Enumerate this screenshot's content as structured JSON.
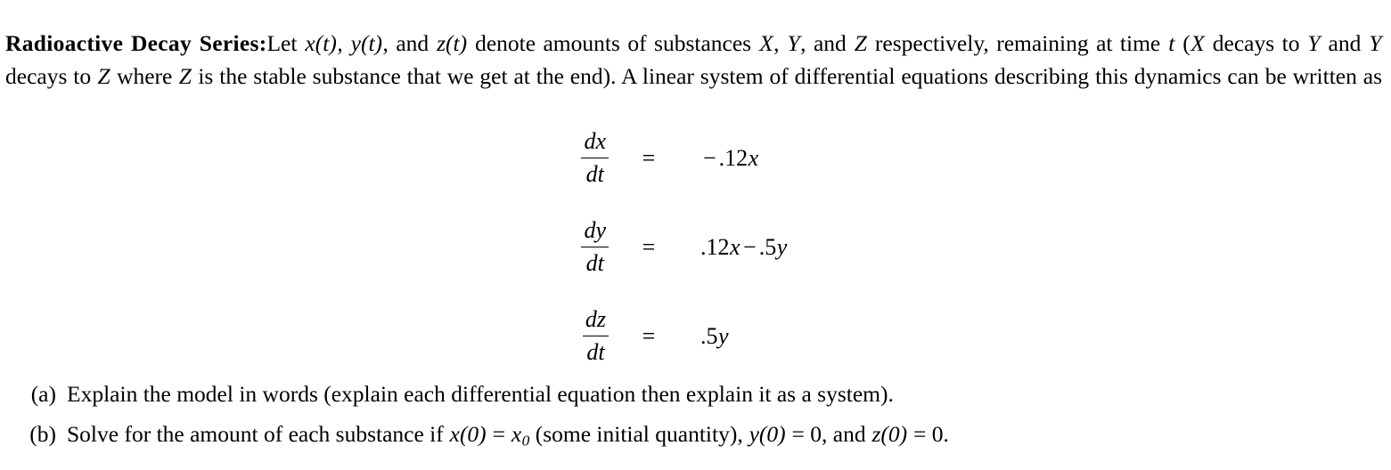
{
  "document": {
    "title_bold": "Radioactive Decay Series:",
    "intro": {
      "seg1": "Let ",
      "var_x_t": "x(t)",
      "seg2": ", ",
      "var_y_t": "y(t)",
      "seg3": ", and ",
      "var_z_t": "z(t)",
      "seg4": " denote amounts of substances ",
      "sub_X": "X",
      "seg5": ", ",
      "sub_Y": "Y",
      "seg6": ", and ",
      "sub_Z": "Z",
      "seg7": " respectively, remaining at time ",
      "var_t": "t",
      "seg8": " (",
      "decay_X": "X",
      "seg9": " decays to ",
      "decay_Y1": "Y",
      "seg10": " and ",
      "decay_Y2": "Y",
      "seg11": " decays to ",
      "decay_Z": "Z",
      "seg12": " where ",
      "stable_Z": "Z",
      "seg13": " is the stable substance that we get at the end). A linear system of differential equations describing this dynamics can be written as"
    },
    "equations": [
      {
        "name": "dx-dt",
        "num": "dx",
        "den": "dt",
        "rel": "=",
        "rhs_minus": "−",
        "rhs_coef": ".12",
        "rhs_var": "x",
        "rhs_plain": "−.12x"
      },
      {
        "name": "dy-dt",
        "num": "dy",
        "den": "dt",
        "rel": "=",
        "rhs_coef": ".12",
        "rhs_var": "x",
        "rhs_op": "−",
        "rhs_coef2": ".5",
        "rhs_var2": "y",
        "rhs_plain": ".12x − .5y"
      },
      {
        "name": "dz-dt",
        "num": "dz",
        "den": "dt",
        "rel": "=",
        "rhs_coef": ".5",
        "rhs_var": "y",
        "rhs_plain": ".5y"
      }
    ],
    "items": [
      {
        "label": "(a)",
        "text": "Explain the model in words (explain each differential equation then explain it as a system)."
      },
      {
        "label": "(b)",
        "prefix": "Solve for the amount of each substance if ",
        "cond1_lhs": "x(0)",
        "cond1_rel": " = ",
        "cond1_rhs": "x",
        "cond1_sub": "0",
        "mid": " (some initial quantity), ",
        "cond2_lhs": "y(0)",
        "cond2_rel": " = ",
        "cond2_rhs": "0",
        "comma": ", and ",
        "cond3_lhs": "z(0)",
        "cond3_rel": " = ",
        "cond3_rhs": "0",
        "period": "."
      }
    ]
  },
  "colors": {
    "background": "#ffffff",
    "text": "#000000",
    "rule": "#000000"
  }
}
